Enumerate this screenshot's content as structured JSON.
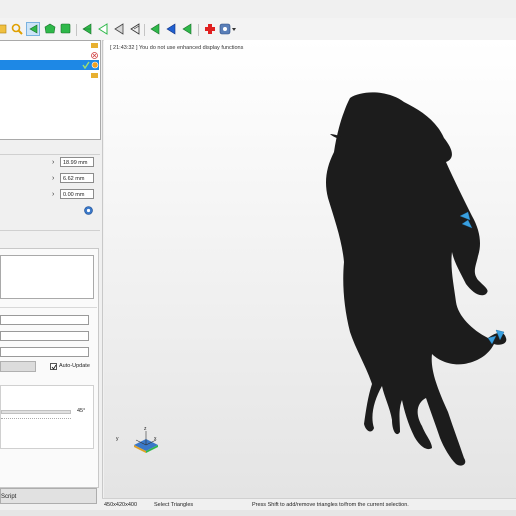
{
  "log_message": "[ 21:43:32 ] You do not use enhanced display functions",
  "parameters": [
    {
      "value": "18.99 mm"
    },
    {
      "value": "6.62 mm"
    },
    {
      "value": "0.00 mm"
    }
  ],
  "auto_update_label": "Auto-Update",
  "auto_update_checked": true,
  "angle_value": "45°",
  "script_button_label": "Script",
  "axis_labels": {
    "x": "x",
    "y": "y",
    "z": "z"
  },
  "status": {
    "dimensions": "450x420x400",
    "mode": "Select Triangles",
    "hint": "Press Shift to add/remove triangles to/from the current selection."
  },
  "colors": {
    "selection": "#1e88e5",
    "model": "#1c1c1c",
    "highlight": "#3aa0e0"
  },
  "toolbar_icons": [
    "folder-icon",
    "search-icon",
    "select-triangle-icon",
    "select-polygon-icon",
    "select-surface-icon",
    "triangle-green-icon",
    "triangle-outline-icon",
    "triangle-gray-icon",
    "triangle-gray-2-icon",
    "triangle-green-2-icon",
    "triangle-blue-icon",
    "triangle-green-3-icon",
    "add-icon",
    "settings-icon"
  ]
}
